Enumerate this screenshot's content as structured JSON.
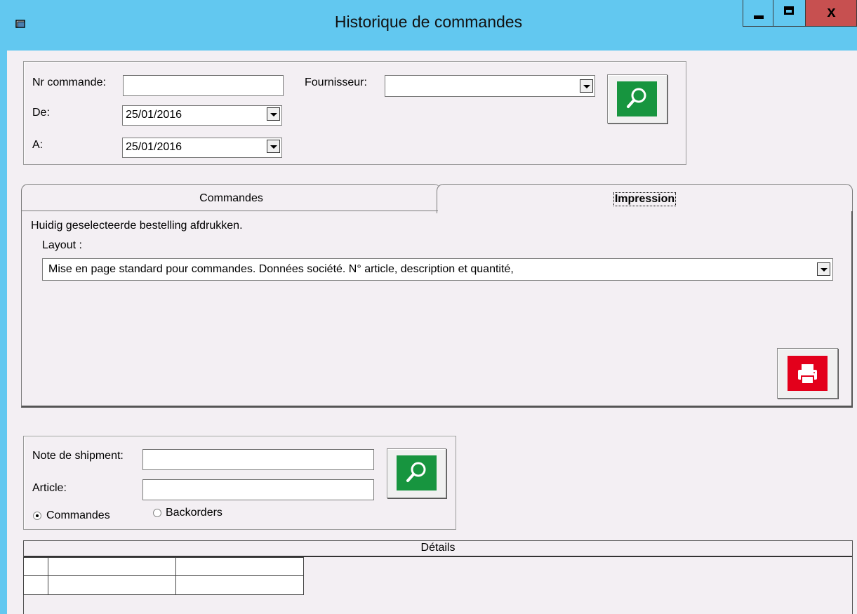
{
  "window": {
    "title": "Historique de commandes",
    "close_glyph": "x",
    "colors": {
      "titlebar": "#62c8f0",
      "close": "#c75050"
    }
  },
  "search": {
    "order_number_label": "Nr commande:",
    "order_number_value": "",
    "from_label": "De:",
    "from_value": "25/01/2016",
    "to_label": "A:",
    "to_value": "25/01/2016",
    "supplier_label": "Fournisseur:",
    "supplier_value": "",
    "search_icon": "magnifier-icon"
  },
  "tabs": [
    {
      "label": "Commandes",
      "active": false
    },
    {
      "label": "Impression",
      "active": true
    }
  ],
  "print_panel": {
    "description": "Huidig geselecteerde bestelling afdrukken.",
    "layout_label": "Layout :",
    "layout_value": "Mise en page standard pour commandes. Données société. N° article, description et quantité,",
    "print_icon": "printer-icon",
    "print_color": "#e3001b"
  },
  "shipment": {
    "shipment_label": "Note de shipment:",
    "shipment_value": "",
    "article_label": "Article:",
    "article_value": "",
    "radio_orders": "Commandes",
    "radio_backorders": "Backorders",
    "selected": "Commandes",
    "search_color": "#17953f"
  },
  "details": {
    "header": "Détails"
  }
}
